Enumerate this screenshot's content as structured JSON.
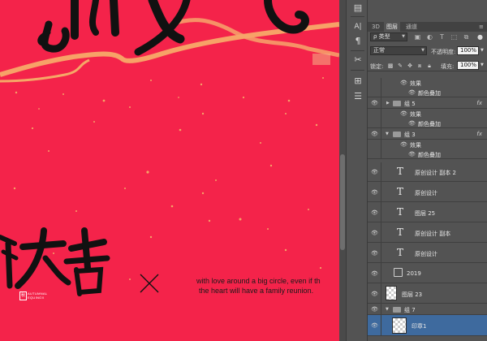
{
  "canvas": {
    "background": "#f4234a",
    "english_line1": "with love around a big circle, even if th",
    "english_line2": "the heart will have a family reunion.",
    "equinox_line1": "AUTUMNAL",
    "equinox_line2": "EQUINOX",
    "seal_char": "秋"
  },
  "toolbar": {
    "tools": [
      {
        "name": "history-icon",
        "glyph": "▤"
      },
      {
        "name": "character-icon",
        "glyph": "A|"
      },
      {
        "name": "paragraph-icon",
        "glyph": "¶"
      },
      {
        "name": "brush-icon",
        "glyph": "✂"
      },
      {
        "name": "clone-source-icon",
        "glyph": "⊞"
      },
      {
        "name": "properties-icon",
        "glyph": "☰"
      }
    ]
  },
  "panel": {
    "tabs": [
      "3D",
      "图层",
      "通道"
    ],
    "active_tab": "图层",
    "filter_label": "ρ 类型",
    "blend_mode": "正常",
    "opacity_label": "不透明度:",
    "opacity_value": "100%",
    "lock_label": "锁定:",
    "fill_label": "填充:",
    "fill_value": "100%",
    "layers": [
      {
        "type": "effect-head",
        "name": "效果"
      },
      {
        "type": "effect",
        "name": "颜色叠加"
      },
      {
        "type": "group",
        "name": "组 5",
        "collapsed": true,
        "fx": "fx"
      },
      {
        "type": "effect-head",
        "name": "效果"
      },
      {
        "type": "effect",
        "name": "颜色叠加"
      },
      {
        "type": "group",
        "name": "组 3",
        "collapsed": false,
        "fx": "fx"
      },
      {
        "type": "effect-head",
        "name": "效果"
      },
      {
        "type": "effect",
        "name": "颜色叠加"
      },
      {
        "type": "text",
        "name": "原创设计 副本 2"
      },
      {
        "type": "text",
        "name": "原创设计"
      },
      {
        "type": "text",
        "name": "图层 25"
      },
      {
        "type": "text",
        "name": "原创设计 副本"
      },
      {
        "type": "text",
        "name": "原创设计"
      },
      {
        "type": "smart",
        "name": "2019"
      },
      {
        "type": "image",
        "name": "图层 23"
      },
      {
        "type": "group",
        "name": "组 7",
        "collapsed": false
      },
      {
        "type": "image-selected",
        "name": "印章1"
      }
    ]
  }
}
